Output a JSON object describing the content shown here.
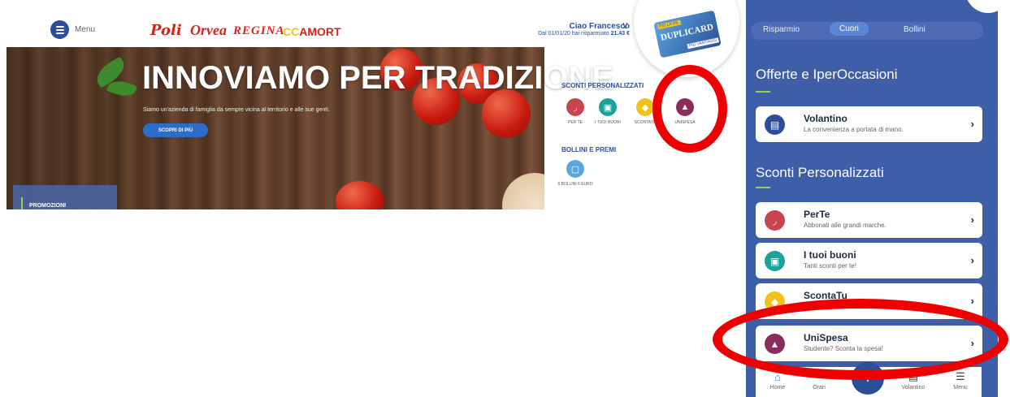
{
  "desktop": {
    "menu_label": "Menu",
    "brands": [
      "Poli",
      "Orvea",
      "REGINA",
      "CC",
      "AMORT"
    ],
    "greeting": {
      "name": "Ciao Francesco",
      "chevron": "∨",
      "savings_prefix": "Dal 01/01/20 hai risparmiato",
      "savings_amount": "21.43 €"
    },
    "card": {
      "tag_top": "PIÙ LA DIL",
      "name": "DUPLICARD",
      "tag_bottom": "PIÙ VANTAGGI"
    },
    "hero": {
      "title": "INNOVIAMO PER TRADIZIONE",
      "subtitle": "Siamo un'azienda di famiglia da sempre vicina al territorio e alle sue genti.",
      "button": "SCOPRI DI PIÙ",
      "promo_label": "PROMOZIONI"
    },
    "sconti": {
      "heading": "SCONTI PERSONALIZZATI",
      "items": [
        {
          "label": "PER TE",
          "icon": "wifi-icon",
          "color": "#c9444f"
        },
        {
          "label": "I TUOI BUONI",
          "icon": "cart-icon",
          "color": "#1aa39a"
        },
        {
          "label": "SCONTATU",
          "icon": "tag-icon",
          "color": "#f2c21b"
        },
        {
          "label": "UNISPESA",
          "icon": "graduation-cap-icon",
          "color": "#8a2d5c"
        }
      ]
    },
    "bollini": {
      "heading": "BOLLINI E PREMI",
      "item": {
        "label": "6 BOLLINI 6 EURO",
        "icon": "sticker-icon",
        "color": "#5aa7dc"
      }
    }
  },
  "mobile": {
    "tabs": [
      "Risparmio",
      "Cuori",
      "Bollini"
    ],
    "active_tab": "Cuori",
    "section1": "Offerte e IperOccasioni",
    "volantino": {
      "title": "Volantino",
      "subtitle": "La convenienza a portata di mano.",
      "icon": "book-icon",
      "color": "#2b4f9a"
    },
    "section2": "Sconti Personalizzati",
    "cards": [
      {
        "title": "PerTe",
        "subtitle": "Abbonati alle grandi marche.",
        "icon": "wifi-icon",
        "color": "#c9444f"
      },
      {
        "title": "I tuoi buoni",
        "subtitle": "Tanti sconti per te!",
        "icon": "cart-icon",
        "color": "#1aa39a"
      },
      {
        "title": "ScontaTu",
        "subtitle": "",
        "icon": "tag-icon",
        "color": "#f2c21b"
      },
      {
        "title": "UniSpesa",
        "subtitle": "Studente? Sconta la spesa!",
        "icon": "graduation-cap-icon",
        "color": "#8a2d5c"
      }
    ],
    "bottom_nav": [
      {
        "label": "Home",
        "icon": "home-icon"
      },
      {
        "label": "Orari",
        "icon": "clock-icon"
      },
      {
        "label": "Volantino",
        "icon": "book-icon"
      },
      {
        "label": "Menu",
        "icon": "menu-icon"
      }
    ],
    "plus_label": "+"
  },
  "colors": {
    "brand_blue": "#2b4f9a",
    "highlight_red": "#ee0000",
    "accent_green": "#9ad052"
  }
}
